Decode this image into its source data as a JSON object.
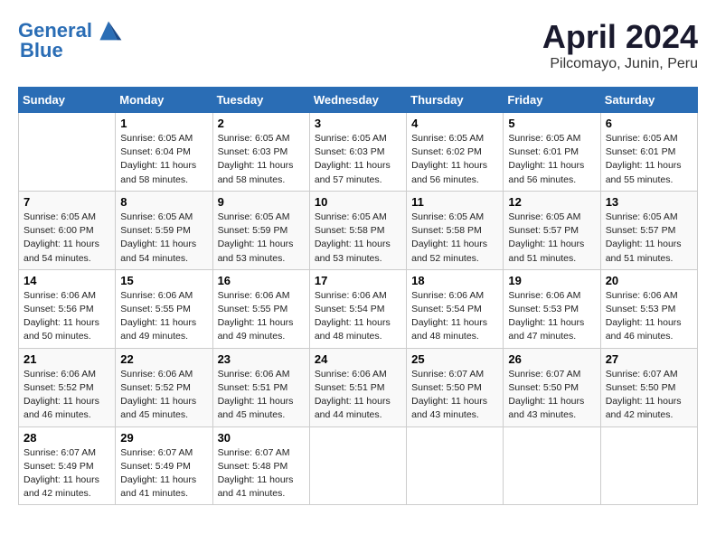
{
  "header": {
    "logo_line1": "General",
    "logo_line2": "Blue",
    "title": "April 2024",
    "subtitle": "Pilcomayo, Junin, Peru"
  },
  "days_of_week": [
    "Sunday",
    "Monday",
    "Tuesday",
    "Wednesday",
    "Thursday",
    "Friday",
    "Saturday"
  ],
  "weeks": [
    [
      {
        "day": "",
        "detail": ""
      },
      {
        "day": "1",
        "detail": "Sunrise: 6:05 AM\nSunset: 6:04 PM\nDaylight: 11 hours\nand 58 minutes."
      },
      {
        "day": "2",
        "detail": "Sunrise: 6:05 AM\nSunset: 6:03 PM\nDaylight: 11 hours\nand 58 minutes."
      },
      {
        "day": "3",
        "detail": "Sunrise: 6:05 AM\nSunset: 6:03 PM\nDaylight: 11 hours\nand 57 minutes."
      },
      {
        "day": "4",
        "detail": "Sunrise: 6:05 AM\nSunset: 6:02 PM\nDaylight: 11 hours\nand 56 minutes."
      },
      {
        "day": "5",
        "detail": "Sunrise: 6:05 AM\nSunset: 6:01 PM\nDaylight: 11 hours\nand 56 minutes."
      },
      {
        "day": "6",
        "detail": "Sunrise: 6:05 AM\nSunset: 6:01 PM\nDaylight: 11 hours\nand 55 minutes."
      }
    ],
    [
      {
        "day": "7",
        "detail": "Sunrise: 6:05 AM\nSunset: 6:00 PM\nDaylight: 11 hours\nand 54 minutes."
      },
      {
        "day": "8",
        "detail": "Sunrise: 6:05 AM\nSunset: 5:59 PM\nDaylight: 11 hours\nand 54 minutes."
      },
      {
        "day": "9",
        "detail": "Sunrise: 6:05 AM\nSunset: 5:59 PM\nDaylight: 11 hours\nand 53 minutes."
      },
      {
        "day": "10",
        "detail": "Sunrise: 6:05 AM\nSunset: 5:58 PM\nDaylight: 11 hours\nand 53 minutes."
      },
      {
        "day": "11",
        "detail": "Sunrise: 6:05 AM\nSunset: 5:58 PM\nDaylight: 11 hours\nand 52 minutes."
      },
      {
        "day": "12",
        "detail": "Sunrise: 6:05 AM\nSunset: 5:57 PM\nDaylight: 11 hours\nand 51 minutes."
      },
      {
        "day": "13",
        "detail": "Sunrise: 6:05 AM\nSunset: 5:57 PM\nDaylight: 11 hours\nand 51 minutes."
      }
    ],
    [
      {
        "day": "14",
        "detail": "Sunrise: 6:06 AM\nSunset: 5:56 PM\nDaylight: 11 hours\nand 50 minutes."
      },
      {
        "day": "15",
        "detail": "Sunrise: 6:06 AM\nSunset: 5:55 PM\nDaylight: 11 hours\nand 49 minutes."
      },
      {
        "day": "16",
        "detail": "Sunrise: 6:06 AM\nSunset: 5:55 PM\nDaylight: 11 hours\nand 49 minutes."
      },
      {
        "day": "17",
        "detail": "Sunrise: 6:06 AM\nSunset: 5:54 PM\nDaylight: 11 hours\nand 48 minutes."
      },
      {
        "day": "18",
        "detail": "Sunrise: 6:06 AM\nSunset: 5:54 PM\nDaylight: 11 hours\nand 48 minutes."
      },
      {
        "day": "19",
        "detail": "Sunrise: 6:06 AM\nSunset: 5:53 PM\nDaylight: 11 hours\nand 47 minutes."
      },
      {
        "day": "20",
        "detail": "Sunrise: 6:06 AM\nSunset: 5:53 PM\nDaylight: 11 hours\nand 46 minutes."
      }
    ],
    [
      {
        "day": "21",
        "detail": "Sunrise: 6:06 AM\nSunset: 5:52 PM\nDaylight: 11 hours\nand 46 minutes."
      },
      {
        "day": "22",
        "detail": "Sunrise: 6:06 AM\nSunset: 5:52 PM\nDaylight: 11 hours\nand 45 minutes."
      },
      {
        "day": "23",
        "detail": "Sunrise: 6:06 AM\nSunset: 5:51 PM\nDaylight: 11 hours\nand 45 minutes."
      },
      {
        "day": "24",
        "detail": "Sunrise: 6:06 AM\nSunset: 5:51 PM\nDaylight: 11 hours\nand 44 minutes."
      },
      {
        "day": "25",
        "detail": "Sunrise: 6:07 AM\nSunset: 5:50 PM\nDaylight: 11 hours\nand 43 minutes."
      },
      {
        "day": "26",
        "detail": "Sunrise: 6:07 AM\nSunset: 5:50 PM\nDaylight: 11 hours\nand 43 minutes."
      },
      {
        "day": "27",
        "detail": "Sunrise: 6:07 AM\nSunset: 5:50 PM\nDaylight: 11 hours\nand 42 minutes."
      }
    ],
    [
      {
        "day": "28",
        "detail": "Sunrise: 6:07 AM\nSunset: 5:49 PM\nDaylight: 11 hours\nand 42 minutes."
      },
      {
        "day": "29",
        "detail": "Sunrise: 6:07 AM\nSunset: 5:49 PM\nDaylight: 11 hours\nand 41 minutes."
      },
      {
        "day": "30",
        "detail": "Sunrise: 6:07 AM\nSunset: 5:48 PM\nDaylight: 11 hours\nand 41 minutes."
      },
      {
        "day": "",
        "detail": ""
      },
      {
        "day": "",
        "detail": ""
      },
      {
        "day": "",
        "detail": ""
      },
      {
        "day": "",
        "detail": ""
      }
    ]
  ]
}
